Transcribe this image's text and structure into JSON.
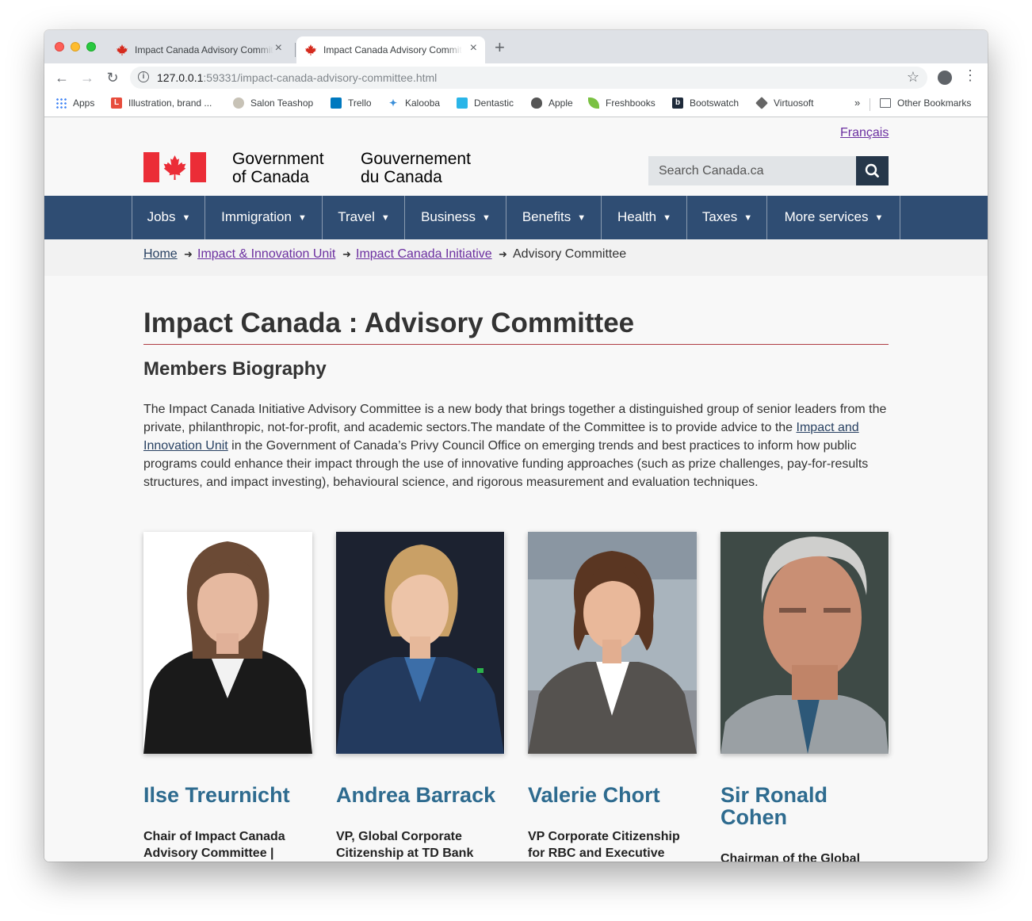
{
  "browser": {
    "tabs": [
      {
        "title": "Impact Canada Advisory Committee",
        "active": false
      },
      {
        "title": "Impact Canada Advisory Committee",
        "active": true
      }
    ],
    "url_host": "127.0.0.1",
    "url_rest": ":59331/impact-canada-advisory-committee.html",
    "bookmarks": [
      {
        "label": "Apps",
        "icon": "apps-grid-icon"
      },
      {
        "label": "Illustration, brand ...",
        "icon": "l-logo-icon"
      },
      {
        "label": "Salon Teashop",
        "icon": "teashop-icon"
      },
      {
        "label": "Trello",
        "icon": "trello-icon"
      },
      {
        "label": "Kalooba",
        "icon": "kalooba-icon"
      },
      {
        "label": "Dentastic",
        "icon": "tooth-icon"
      },
      {
        "label": "Apple",
        "icon": "apple-icon"
      },
      {
        "label": "Freshbooks",
        "icon": "leaf-icon"
      },
      {
        "label": "Bootswatch",
        "icon": "bootswatch-icon"
      },
      {
        "label": "Virtuosoft",
        "icon": "virtuosoft-icon"
      }
    ],
    "bookmarks_overflow": "»",
    "other_bookmarks": "Other Bookmarks"
  },
  "header": {
    "language_link": "Français",
    "signature_en_line1": "Government",
    "signature_en_line2": "of Canada",
    "signature_fr_line1": "Gouvernement",
    "signature_fr_line2": "du Canada",
    "search_placeholder": "Search Canada.ca"
  },
  "colors": {
    "nav_bg": "#2f4d73",
    "search_button": "#26374a",
    "name_color": "#2e6b8f",
    "rule_color": "#af3c43",
    "flag_red": "#eb2d37"
  },
  "nav": [
    {
      "label": "Jobs"
    },
    {
      "label": "Immigration"
    },
    {
      "label": "Travel"
    },
    {
      "label": "Business"
    },
    {
      "label": "Benefits"
    },
    {
      "label": "Health"
    },
    {
      "label": "Taxes"
    },
    {
      "label": "More services"
    }
  ],
  "breadcrumb": [
    {
      "label": "Home"
    },
    {
      "label": "Impact & Innovation Unit"
    },
    {
      "label": "Impact Canada Initiative"
    },
    {
      "label": "Advisory Committee"
    }
  ],
  "page": {
    "title": "Impact Canada : Advisory Committee",
    "subtitle": "Members Biography",
    "intro_part1": "The Impact Canada Initiative Advisory Committee is a new body that brings together a distinguished group of senior leaders from the private, philanthropic, not-for-profit, and academic sectors.The mandate of the Committee is to provide advice to the ",
    "intro_link": "Impact and Innovation Unit",
    "intro_part2": " in the Government of Canada’s Privy Council Office on emerging trends and best practices to inform how public programs could enhance their impact through the use of innovative funding approaches (such as prize challenges, pay-for-results structures, and impact investing), behavioural science, and rigorous measurement and evaluation techniques."
  },
  "members": [
    {
      "name": "Ilse Treurnicht",
      "role": "Chair of Impact Canada Advisory Committee | Former CEO, MaRS"
    },
    {
      "name": "Andrea Barrack",
      "role": "VP, Global Corporate Citizenship at TD Bank Group"
    },
    {
      "name": "Valerie Chort",
      "role": "VP Corporate Citizenship for RBC and Executive Director of the RBC"
    },
    {
      "name": "Sir Ronald Cohen",
      "role": "Chairman of the Global"
    }
  ]
}
